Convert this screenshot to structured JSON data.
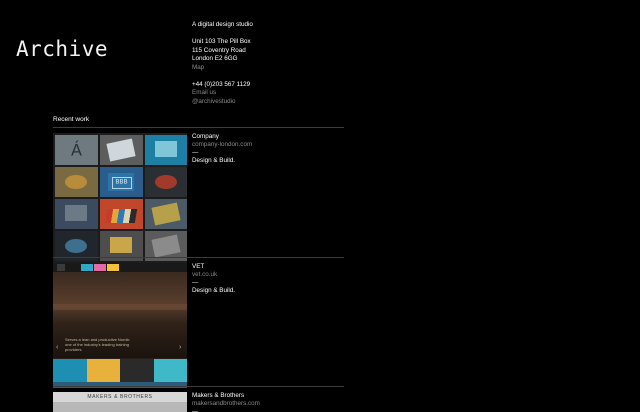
{
  "site": {
    "logo": "Archive"
  },
  "studio": {
    "tagline": "A digital design studio",
    "address": [
      "Unit 103 The Pill Box",
      "115 Coventry Road",
      "London E2 6GG"
    ],
    "map_link": "Map",
    "phone": "+44 (0)203 567 1129",
    "email_link": "Email us",
    "social_link": "@archivestudio"
  },
  "recent_work": {
    "title": "Recent work",
    "projects": [
      {
        "name": "Company",
        "url": "company-london.com",
        "dash": "—",
        "services": "Design & Build."
      },
      {
        "name": "VET",
        "url": "vet.co.uk",
        "dash": "—",
        "services": "Design & Build."
      },
      {
        "name": "Makers & Brothers",
        "url": "makersandbrothers.com",
        "dash": "—",
        "services": ""
      }
    ]
  },
  "thumbs": {
    "company_glyph": "Á",
    "company_tile": "BBB",
    "vet_caption": "Serves a lean and productive Nordic one of the industry's leading training providers",
    "makers_brand": "MAKERS & BROTHERS"
  },
  "colors": {
    "background": "#000000",
    "text": "#ffffff",
    "muted": "#8a8a8a",
    "rule": "#3c3c3c"
  }
}
